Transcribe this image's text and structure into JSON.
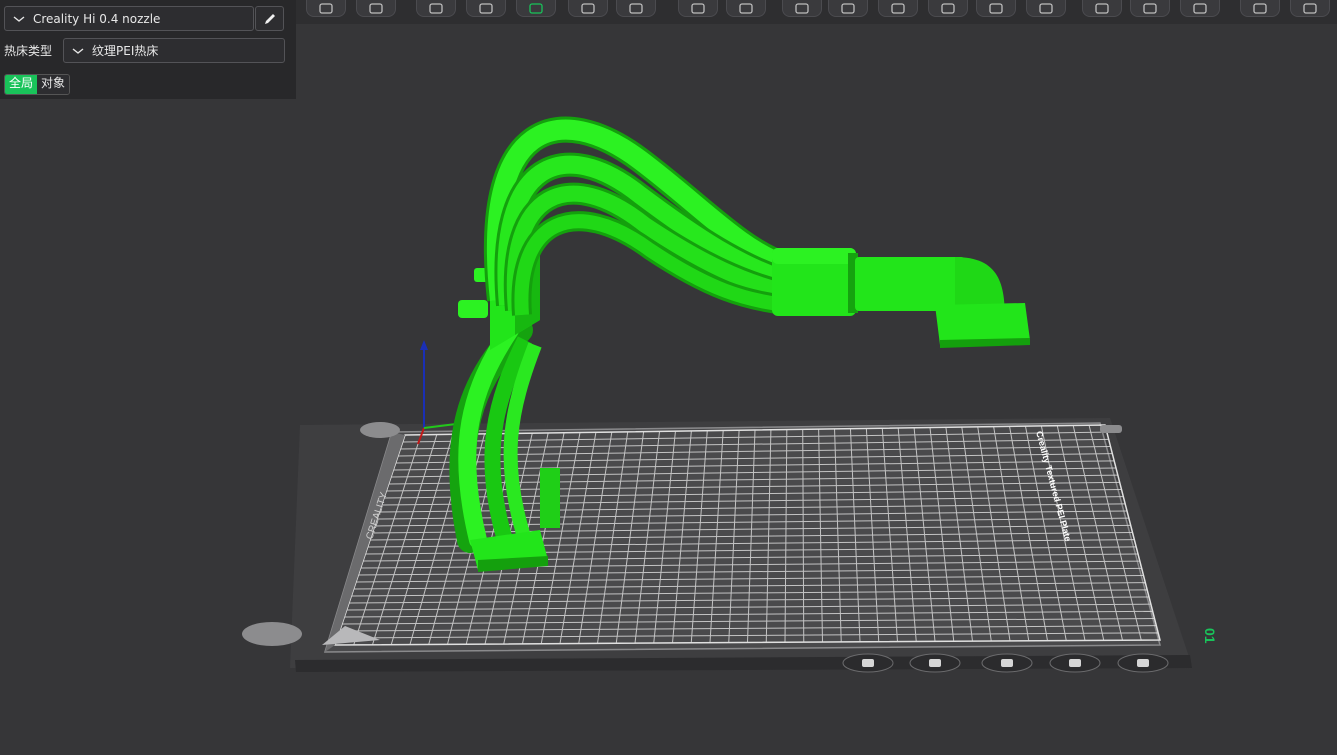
{
  "panel": {
    "printer_name": "Creality Hi 0.4 nozzle",
    "bed_type_label": "热床类型",
    "bed_type_value": "纹理PEI热床",
    "mode_global": "全局",
    "mode_object": "对象"
  },
  "toolbar": {
    "buttons": [
      {
        "name": "add-cube-icon"
      },
      {
        "name": "grid-icon"
      },
      {
        "name": "auto-orient-icon"
      },
      {
        "name": "lay-on-face-icon"
      },
      {
        "name": "slice-view-icon"
      },
      {
        "name": "arrange-icon"
      },
      {
        "name": "split-icon"
      },
      {
        "name": "split-parts-icon"
      },
      {
        "name": "settings-parts-icon"
      },
      {
        "name": "measure-icon"
      },
      {
        "name": "layers-icon"
      },
      {
        "name": "fill-icon"
      },
      {
        "name": "cut-icon"
      },
      {
        "name": "boolean-icon"
      },
      {
        "name": "support-paint-icon"
      },
      {
        "name": "seam-paint-icon"
      },
      {
        "name": "fuzzy-skin-icon"
      },
      {
        "name": "text-emboss-icon"
      },
      {
        "name": "mmu-paint-icon"
      },
      {
        "name": "assembly-icon"
      },
      {
        "name": "auto-print-icon"
      }
    ]
  },
  "viewport": {
    "bed_brand": "CREALITY",
    "bed_side_text": "Creality Textured PEI Plate",
    "plate_number": "01",
    "colors": {
      "background": "#363638",
      "model": "#22e51a",
      "bed": "#4a4a4c",
      "grid": "#d9d9d9",
      "accent": "#19c35a"
    },
    "plate_buttons": [
      {
        "name": "plate-settings-icon"
      },
      {
        "name": "plate-lock-icon"
      },
      {
        "name": "plate-paint-icon"
      },
      {
        "name": "plate-arrange-icon"
      },
      {
        "name": "plate-delete-icon"
      }
    ]
  }
}
